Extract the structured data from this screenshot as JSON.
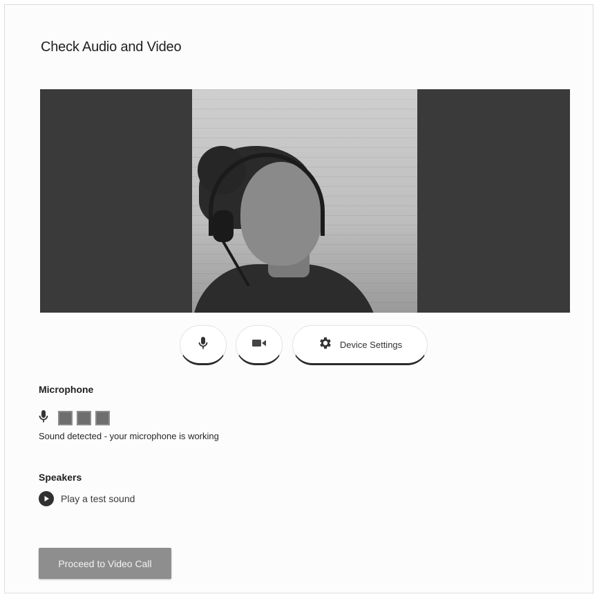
{
  "dialog": {
    "title": "Check Audio and Video"
  },
  "controls": {
    "mic_icon": "microphone-icon",
    "camera_icon": "video-camera-icon",
    "settings_icon": "gear-icon",
    "settings_label": "Device Settings"
  },
  "microphone": {
    "heading": "Microphone",
    "level_segments_active": 3,
    "status": "Sound detected - your microphone is working"
  },
  "speakers": {
    "heading": "Speakers",
    "play_icon": "play-icon",
    "play_label": "Play a test sound"
  },
  "footer": {
    "proceed_label": "Proceed to Video Call"
  }
}
